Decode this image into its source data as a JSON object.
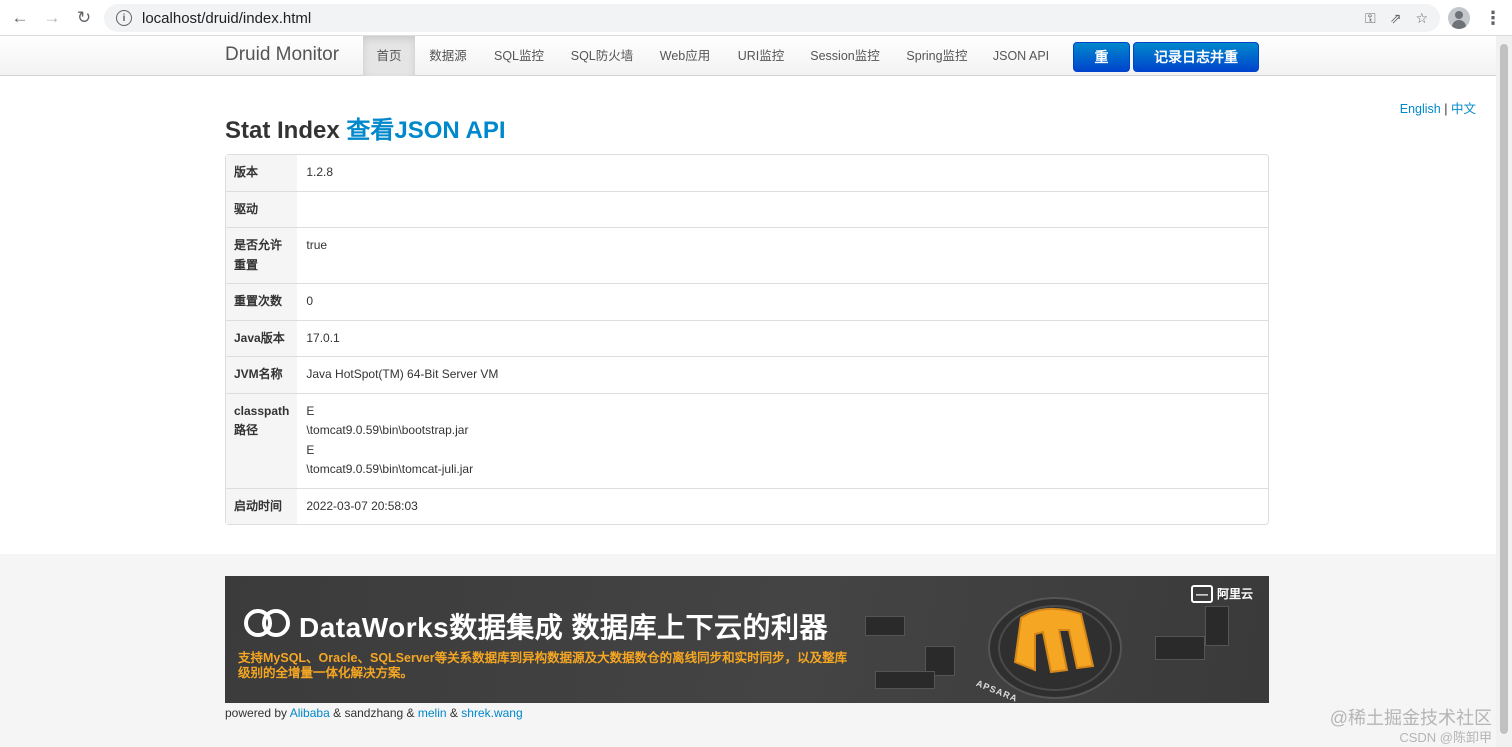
{
  "browser": {
    "url": "localhost/druid/index.html"
  },
  "navbar": {
    "brand": "Druid Monitor",
    "items": [
      {
        "label": "首页",
        "active": true
      },
      {
        "label": "数据源"
      },
      {
        "label": "SQL监控"
      },
      {
        "label": "SQL防火墙"
      },
      {
        "label": "Web应用"
      },
      {
        "label": "URI监控"
      },
      {
        "label": "Session监控"
      },
      {
        "label": "Spring监控"
      },
      {
        "label": "JSON API"
      }
    ],
    "reset_button": "重置",
    "log_reset_button": "记录日志并重置"
  },
  "lang": {
    "english": "English",
    "separator": "|",
    "chinese": "中文"
  },
  "page": {
    "title": "Stat Index",
    "json_link": "查看JSON API"
  },
  "stats": [
    {
      "key": "版本",
      "value": [
        "1.2.8"
      ]
    },
    {
      "key": "驱动",
      "value": [
        ""
      ]
    },
    {
      "key": "是否允许重置",
      "value": [
        "true"
      ]
    },
    {
      "key": "重置次数",
      "value": [
        "0"
      ]
    },
    {
      "key": "Java版本",
      "value": [
        "17.0.1"
      ]
    },
    {
      "key": "JVM名称",
      "value": [
        "Java HotSpot(TM) 64-Bit Server VM"
      ]
    },
    {
      "key": "classpath路径",
      "value": [
        "E",
        "\\tomcat9.0.59\\bin\\bootstrap.jar",
        "E",
        "\\tomcat9.0.59\\bin\\tomcat-juli.jar"
      ]
    },
    {
      "key": "启动时间",
      "value": [
        "2022-03-07 20:58:03"
      ]
    }
  ],
  "banner": {
    "title": "DataWorks数据集成 数据库上下云的利器",
    "subtitle": "支持MySQL、Oracle、SQLServer等关系数据库到异构数据源及大数据数仓的离线同步和实时同步，以及整库级别的全增量一体化解决方案。",
    "brand": "阿里云",
    "apsara": "APSARA"
  },
  "footer": {
    "powered_by": "powered by",
    "alibaba": "Alibaba",
    "amp1": "&",
    "sandzhang": "sandzhang",
    "amp2": "&",
    "melin": "melin",
    "amp3": "&",
    "shrek": "shrek.wang"
  },
  "watermark": {
    "line1": "@稀土掘金技术社区",
    "line2": "CSDN @陈卸甲"
  },
  "colors": {
    "link": "#0088cc",
    "primary_button": "#0044cc",
    "banner_accent": "#f5a623"
  }
}
